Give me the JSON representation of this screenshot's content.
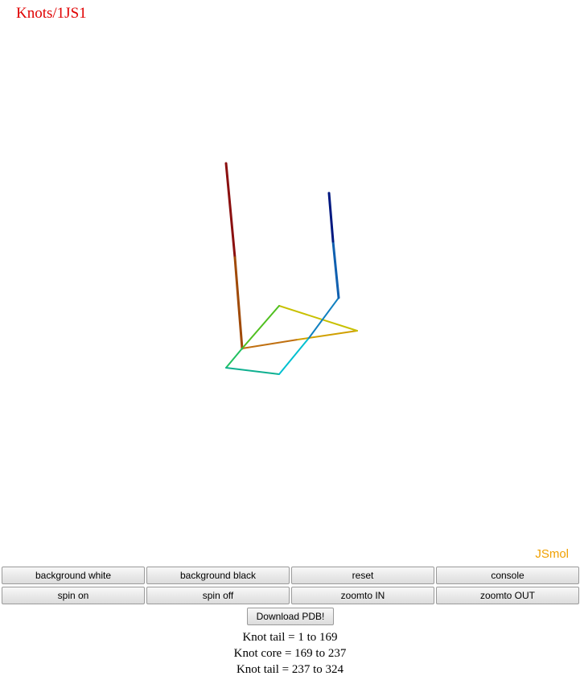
{
  "page": {
    "title": "Knots/1JS1"
  },
  "viewer": {
    "logo": "JSmol"
  },
  "controls": {
    "buttons": [
      {
        "label": "background white",
        "name": "background-white-button"
      },
      {
        "label": "background black",
        "name": "background-black-button"
      },
      {
        "label": "reset",
        "name": "reset-button"
      },
      {
        "label": "console",
        "name": "console-button"
      },
      {
        "label": "spin on",
        "name": "spin-on-button"
      },
      {
        "label": "spin off",
        "name": "spin-off-button"
      },
      {
        "label": "zoomto IN",
        "name": "zoomto-in-button"
      },
      {
        "label": "zoomto OUT",
        "name": "zoomto-out-button"
      }
    ],
    "download_label": "Download PDB!"
  },
  "knot_info": {
    "lines": [
      "Knot tail = 1 to 169",
      "Knot core = 169 to 237",
      "Knot tail = 237 to 324"
    ]
  },
  "colors": {
    "title": "#e00000",
    "logo": "#f0a000",
    "chain_gradient": [
      "#8b0000",
      "#c06000",
      "#d4c000",
      "#40d000",
      "#00c0c0",
      "#1060c0",
      "#00107a"
    ]
  }
}
